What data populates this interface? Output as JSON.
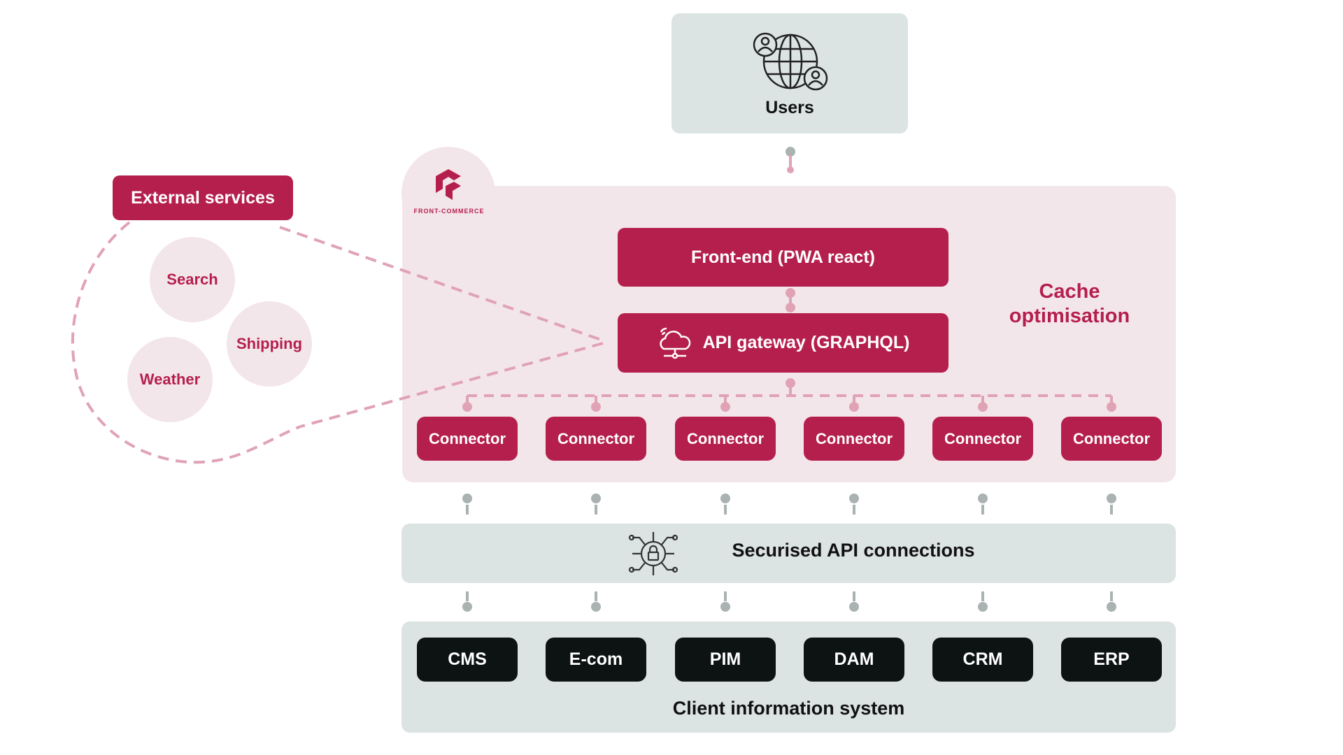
{
  "users": {
    "label": "Users",
    "icon": "globe-users-icon"
  },
  "logo": {
    "text": "FRONT-COMMERCE"
  },
  "frontend": {
    "label": "Front-end (PWA react)"
  },
  "gateway": {
    "label": "API gateway (GRAPHQL)",
    "icon": "cloud-network-icon"
  },
  "cache": {
    "line1": "Cache",
    "line2": "optimisation"
  },
  "connectors": [
    "Connector",
    "Connector",
    "Connector",
    "Connector",
    "Connector",
    "Connector"
  ],
  "secured": {
    "label": "Securised API connections",
    "icon": "lock-circuit-icon"
  },
  "systems": [
    "CMS",
    "E-com",
    "PIM",
    "DAM",
    "CRM",
    "ERP"
  ],
  "client": {
    "label": "Client information system"
  },
  "external": {
    "label": "External services",
    "services": [
      "Search",
      "Shipping",
      "Weather"
    ]
  },
  "colors": {
    "crimson": "#b51f4e",
    "pink": "#f3e6ea",
    "gray": "#dce3e3",
    "black": "#0d1212"
  }
}
